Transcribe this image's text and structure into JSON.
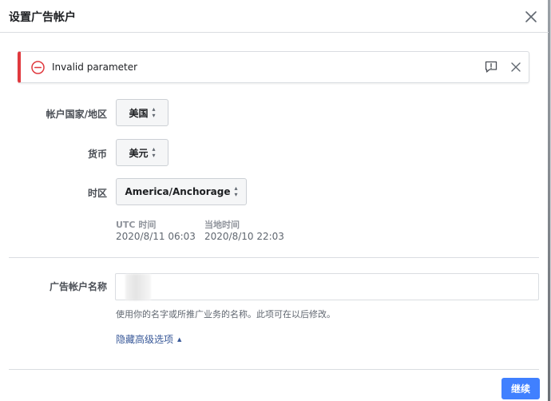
{
  "dialog": {
    "title": "设置广告帐户"
  },
  "error_banner": {
    "message": "Invalid parameter",
    "accent_color": "#e0393e"
  },
  "form": {
    "country": {
      "label": "帐户国家/地区",
      "value": "美国"
    },
    "currency": {
      "label": "货币",
      "value": "美元"
    },
    "timezone": {
      "label": "时区",
      "value": "America/Anchorage"
    },
    "times": {
      "utc_label": "UTC 时间",
      "utc_value": "2020/8/11 06:03",
      "local_label": "当地时间",
      "local_value": "2020/8/10 22:03"
    },
    "account_name": {
      "label": "广告帐户名称",
      "value": "",
      "help_text": "使用你的名字或所推广业务的名称。此项可在以后修改。"
    },
    "advanced_link": "隐藏高级选项"
  },
  "footer": {
    "continue_label": "继续",
    "button_color": "#4080ff"
  }
}
